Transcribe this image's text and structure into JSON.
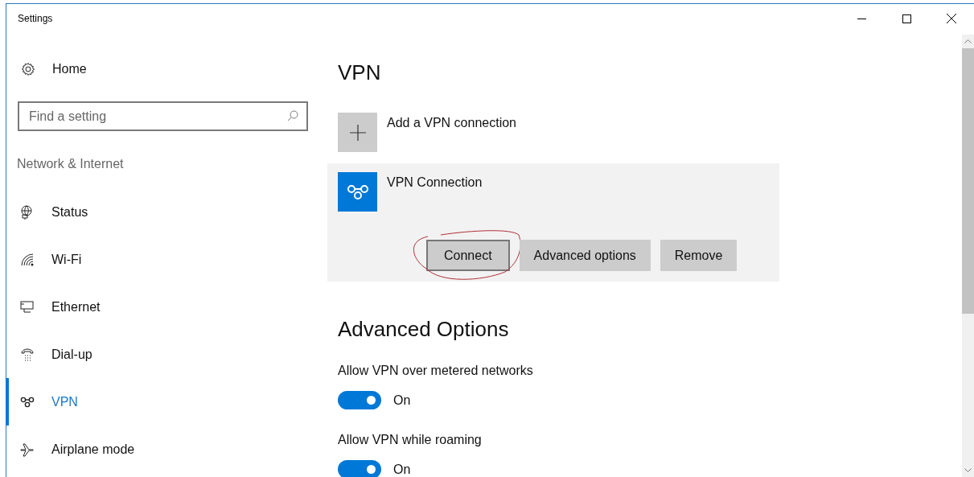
{
  "window": {
    "title": "Settings"
  },
  "sidebar": {
    "home": "Home",
    "search": {
      "placeholder": "Find a setting"
    },
    "category": "Network & Internet",
    "items": [
      {
        "label": "Status",
        "selected": false
      },
      {
        "label": "Wi-Fi",
        "selected": false
      },
      {
        "label": "Ethernet",
        "selected": false
      },
      {
        "label": "Dial-up",
        "selected": false
      },
      {
        "label": "VPN",
        "selected": true
      },
      {
        "label": "Airplane mode",
        "selected": false
      }
    ]
  },
  "content": {
    "title": "VPN",
    "add_connection": "Add a VPN connection",
    "connection": {
      "name": "VPN Connection",
      "buttons": [
        {
          "label": "Connect",
          "focused": true
        },
        {
          "label": "Advanced options",
          "focused": false
        },
        {
          "label": "Remove",
          "focused": false
        }
      ]
    },
    "advanced_title": "Advanced Options",
    "options": [
      {
        "label": "Allow VPN over metered networks",
        "on": true,
        "state": "On"
      },
      {
        "label": "Allow VPN while roaming",
        "on": true,
        "state": "On"
      }
    ]
  }
}
